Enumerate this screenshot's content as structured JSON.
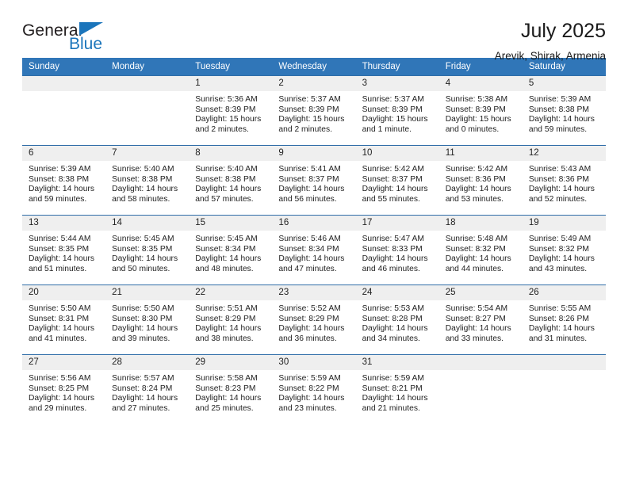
{
  "brand": {
    "name_top": "General",
    "name_bottom": "Blue",
    "accent_color": "#1b75bb"
  },
  "header": {
    "title": "July 2025",
    "location": "Arevik, Shirak, Armenia"
  },
  "theme": {
    "header_bg": "#3076b8",
    "row_border": "#2f6da8",
    "daybar_bg": "#efefef"
  },
  "calendar": {
    "weekday_headers": [
      "Sunday",
      "Monday",
      "Tuesday",
      "Wednesday",
      "Thursday",
      "Friday",
      "Saturday"
    ],
    "weeks": [
      [
        {
          "day": "",
          "blank": true,
          "lines": []
        },
        {
          "day": "",
          "blank": true,
          "lines": []
        },
        {
          "day": "1",
          "lines": [
            "Sunrise: 5:36 AM",
            "Sunset: 8:39 PM",
            "Daylight: 15 hours",
            "and 2 minutes."
          ]
        },
        {
          "day": "2",
          "lines": [
            "Sunrise: 5:37 AM",
            "Sunset: 8:39 PM",
            "Daylight: 15 hours",
            "and 2 minutes."
          ]
        },
        {
          "day": "3",
          "lines": [
            "Sunrise: 5:37 AM",
            "Sunset: 8:39 PM",
            "Daylight: 15 hours",
            "and 1 minute."
          ]
        },
        {
          "day": "4",
          "lines": [
            "Sunrise: 5:38 AM",
            "Sunset: 8:39 PM",
            "Daylight: 15 hours",
            "and 0 minutes."
          ]
        },
        {
          "day": "5",
          "lines": [
            "Sunrise: 5:39 AM",
            "Sunset: 8:38 PM",
            "Daylight: 14 hours",
            "and 59 minutes."
          ]
        }
      ],
      [
        {
          "day": "6",
          "lines": [
            "Sunrise: 5:39 AM",
            "Sunset: 8:38 PM",
            "Daylight: 14 hours",
            "and 59 minutes."
          ]
        },
        {
          "day": "7",
          "lines": [
            "Sunrise: 5:40 AM",
            "Sunset: 8:38 PM",
            "Daylight: 14 hours",
            "and 58 minutes."
          ]
        },
        {
          "day": "8",
          "lines": [
            "Sunrise: 5:40 AM",
            "Sunset: 8:38 PM",
            "Daylight: 14 hours",
            "and 57 minutes."
          ]
        },
        {
          "day": "9",
          "lines": [
            "Sunrise: 5:41 AM",
            "Sunset: 8:37 PM",
            "Daylight: 14 hours",
            "and 56 minutes."
          ]
        },
        {
          "day": "10",
          "lines": [
            "Sunrise: 5:42 AM",
            "Sunset: 8:37 PM",
            "Daylight: 14 hours",
            "and 55 minutes."
          ]
        },
        {
          "day": "11",
          "lines": [
            "Sunrise: 5:42 AM",
            "Sunset: 8:36 PM",
            "Daylight: 14 hours",
            "and 53 minutes."
          ]
        },
        {
          "day": "12",
          "lines": [
            "Sunrise: 5:43 AM",
            "Sunset: 8:36 PM",
            "Daylight: 14 hours",
            "and 52 minutes."
          ]
        }
      ],
      [
        {
          "day": "13",
          "lines": [
            "Sunrise: 5:44 AM",
            "Sunset: 8:35 PM",
            "Daylight: 14 hours",
            "and 51 minutes."
          ]
        },
        {
          "day": "14",
          "lines": [
            "Sunrise: 5:45 AM",
            "Sunset: 8:35 PM",
            "Daylight: 14 hours",
            "and 50 minutes."
          ]
        },
        {
          "day": "15",
          "lines": [
            "Sunrise: 5:45 AM",
            "Sunset: 8:34 PM",
            "Daylight: 14 hours",
            "and 48 minutes."
          ]
        },
        {
          "day": "16",
          "lines": [
            "Sunrise: 5:46 AM",
            "Sunset: 8:34 PM",
            "Daylight: 14 hours",
            "and 47 minutes."
          ]
        },
        {
          "day": "17",
          "lines": [
            "Sunrise: 5:47 AM",
            "Sunset: 8:33 PM",
            "Daylight: 14 hours",
            "and 46 minutes."
          ]
        },
        {
          "day": "18",
          "lines": [
            "Sunrise: 5:48 AM",
            "Sunset: 8:32 PM",
            "Daylight: 14 hours",
            "and 44 minutes."
          ]
        },
        {
          "day": "19",
          "lines": [
            "Sunrise: 5:49 AM",
            "Sunset: 8:32 PM",
            "Daylight: 14 hours",
            "and 43 minutes."
          ]
        }
      ],
      [
        {
          "day": "20",
          "lines": [
            "Sunrise: 5:50 AM",
            "Sunset: 8:31 PM",
            "Daylight: 14 hours",
            "and 41 minutes."
          ]
        },
        {
          "day": "21",
          "lines": [
            "Sunrise: 5:50 AM",
            "Sunset: 8:30 PM",
            "Daylight: 14 hours",
            "and 39 minutes."
          ]
        },
        {
          "day": "22",
          "lines": [
            "Sunrise: 5:51 AM",
            "Sunset: 8:29 PM",
            "Daylight: 14 hours",
            "and 38 minutes."
          ]
        },
        {
          "day": "23",
          "lines": [
            "Sunrise: 5:52 AM",
            "Sunset: 8:29 PM",
            "Daylight: 14 hours",
            "and 36 minutes."
          ]
        },
        {
          "day": "24",
          "lines": [
            "Sunrise: 5:53 AM",
            "Sunset: 8:28 PM",
            "Daylight: 14 hours",
            "and 34 minutes."
          ]
        },
        {
          "day": "25",
          "lines": [
            "Sunrise: 5:54 AM",
            "Sunset: 8:27 PM",
            "Daylight: 14 hours",
            "and 33 minutes."
          ]
        },
        {
          "day": "26",
          "lines": [
            "Sunrise: 5:55 AM",
            "Sunset: 8:26 PM",
            "Daylight: 14 hours",
            "and 31 minutes."
          ]
        }
      ],
      [
        {
          "day": "27",
          "lines": [
            "Sunrise: 5:56 AM",
            "Sunset: 8:25 PM",
            "Daylight: 14 hours",
            "and 29 minutes."
          ]
        },
        {
          "day": "28",
          "lines": [
            "Sunrise: 5:57 AM",
            "Sunset: 8:24 PM",
            "Daylight: 14 hours",
            "and 27 minutes."
          ]
        },
        {
          "day": "29",
          "lines": [
            "Sunrise: 5:58 AM",
            "Sunset: 8:23 PM",
            "Daylight: 14 hours",
            "and 25 minutes."
          ]
        },
        {
          "day": "30",
          "lines": [
            "Sunrise: 5:59 AM",
            "Sunset: 8:22 PM",
            "Daylight: 14 hours",
            "and 23 minutes."
          ]
        },
        {
          "day": "31",
          "lines": [
            "Sunrise: 5:59 AM",
            "Sunset: 8:21 PM",
            "Daylight: 14 hours",
            "and 21 minutes."
          ]
        },
        {
          "day": "",
          "blank": true,
          "lines": []
        },
        {
          "day": "",
          "blank": true,
          "lines": []
        }
      ]
    ]
  }
}
